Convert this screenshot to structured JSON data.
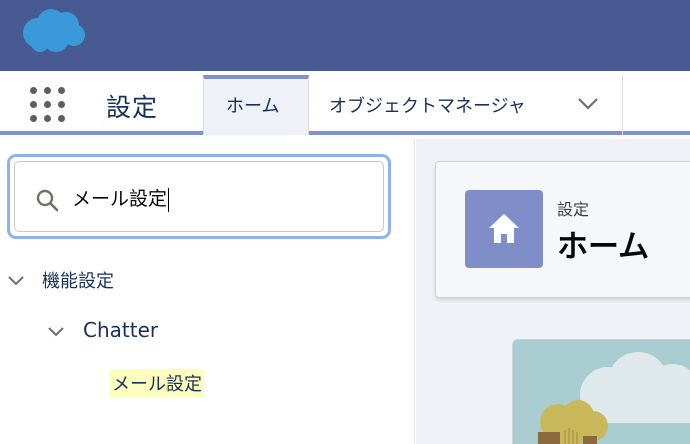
{
  "global_header": {
    "logo_icon": "salesforce-cloud-logo",
    "bg_color": "#475a91"
  },
  "context_bar": {
    "app_launcher_icon": "waffle-grid-icon",
    "app_name": "設定",
    "tabs": [
      {
        "label": "ホーム",
        "active": true
      },
      {
        "label": "オブジェクトマネージャ",
        "active": false,
        "icon": "chevron-down-icon"
      }
    ],
    "accent_color": "#8191cc"
  },
  "sidebar": {
    "search": {
      "value": "メール設定",
      "icon": "search-icon"
    },
    "tree": [
      {
        "label": "機能設定",
        "icon": "chevron-down-icon"
      },
      {
        "label": "Chatter",
        "icon": "chevron-down-icon"
      },
      {
        "label": "メール設定",
        "highlight": true
      }
    ]
  },
  "content": {
    "header": {
      "breadcrumb": "設定",
      "title": "ホーム",
      "icon": "home-icon",
      "icon_bg": "#7f8ec8"
    },
    "illustration": "landscape-illustration"
  }
}
